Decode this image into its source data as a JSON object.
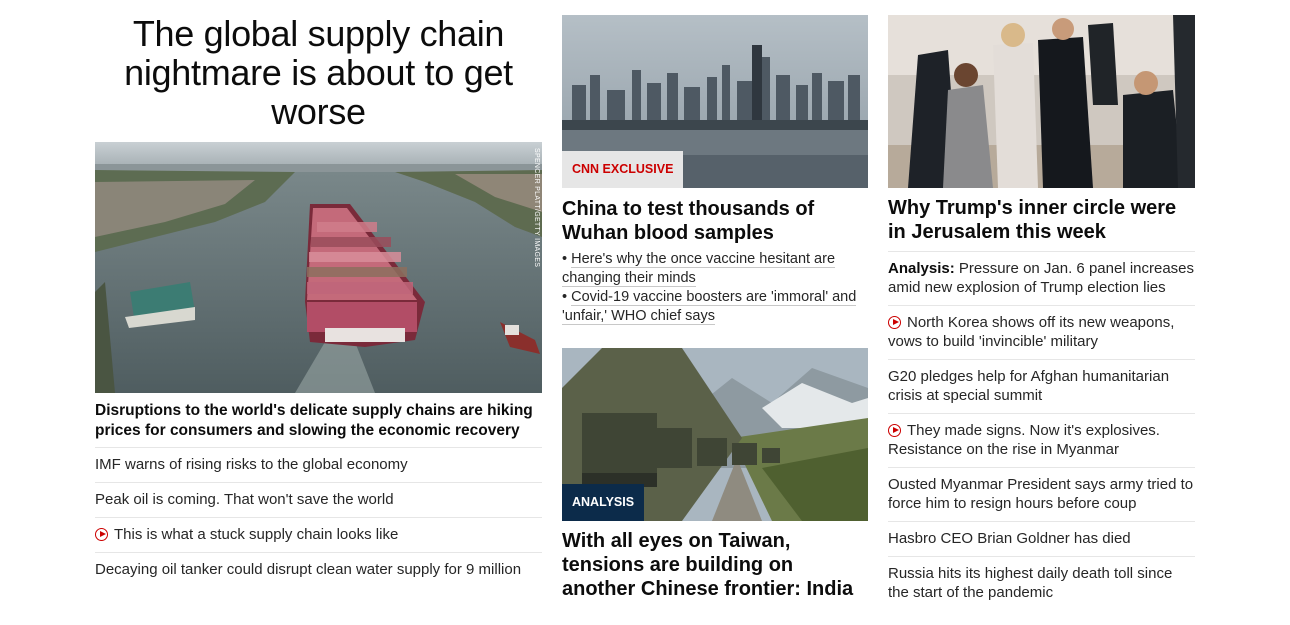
{
  "hero": {
    "headline": "The global supply chain nightmare is about to get worse",
    "image_credit": "SPENCER PLATT/GETTY IMAGES",
    "summary": "Disruptions to the world's delicate supply chains are hiking prices for consumers and slowing the economic recovery",
    "links": [
      {
        "text": "IMF warns of rising risks to the global economy",
        "video": false
      },
      {
        "text": "Peak oil is coming. That won't save the world",
        "video": false
      },
      {
        "text": "This is what a stuck supply chain looks like",
        "video": true
      },
      {
        "text": "Decaying oil tanker could disrupt clean water supply for 9 million",
        "video": false
      }
    ]
  },
  "middle": {
    "card1": {
      "badge": "CNN EXCLUSIVE",
      "title": "China to test thousands of Wuhan blood samples",
      "bullets": [
        "Here's why the once vaccine hesitant are changing their minds",
        "Covid-19 vaccine boosters are 'immoral' and 'unfair,' WHO chief says"
      ]
    },
    "card2": {
      "badge": "ANALYSIS",
      "title": "With all eyes on Taiwan, tensions are building on another Chinese frontier: India"
    }
  },
  "right": {
    "title": "Why Trump's inner circle were in Jerusalem this week",
    "links": [
      {
        "label": "Analysis:",
        "text": "Pressure on Jan. 6 panel increases amid new explosion of Trump election lies",
        "video": false
      },
      {
        "label": "",
        "text": "North Korea shows off its new weapons, vows to build 'invincible' military",
        "video": true
      },
      {
        "label": "",
        "text": "G20 pledges help for Afghan humanitarian crisis at special summit",
        "video": false
      },
      {
        "label": "",
        "text": "They made signs. Now it's explosives. Resistance on the rise in Myanmar",
        "video": true
      },
      {
        "label": "",
        "text": "Ousted Myanmar President says army tried to force him to resign hours before coup",
        "video": false
      },
      {
        "label": "",
        "text": "Hasbro CEO Brian Goldner has died",
        "video": false
      },
      {
        "label": "",
        "text": "Russia hits its highest daily death toll since the start of the pandemic",
        "video": false
      }
    ]
  },
  "colors": {
    "accent_red": "#cc0000",
    "analysis_badge": "#0c2b4a",
    "divider": "#e6e6e6"
  }
}
